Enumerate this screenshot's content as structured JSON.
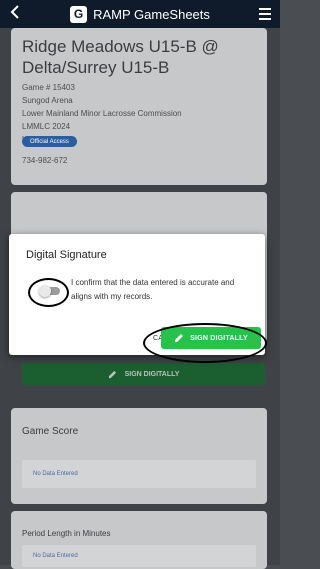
{
  "header": {
    "back_icon": "chevron-left-icon",
    "logo_letter": "G",
    "title": "RAMP GameSheets",
    "menu_icon": "hamburger-icon"
  },
  "game": {
    "title": "Ridge Meadows U15-B @ Delta/Surrey U15-B",
    "game_number": "Game # 15403",
    "arena": "Sungod Arena",
    "association": "Lower Mainland Minor Lacrosse Commission",
    "league": "LMMLC 2024",
    "division": "U-15 B",
    "badge": "Official Access",
    "phone": "734-982-672"
  },
  "signature_section": {
    "button_label": "SIGN DIGITALLY",
    "button_icon": "pencil-icon"
  },
  "modal": {
    "title": "Digital Signature",
    "message": "I confirm that the data entered is accurate and aligns with my records.",
    "cancel_label": "CANCEL",
    "sign_label": "SIGN DIGITALLY",
    "toggle_checked": false
  },
  "score": {
    "heading": "Game Score",
    "empty": "No Data Entered"
  },
  "period": {
    "heading": "Period Length in Minutes",
    "empty": "No Data Entered"
  },
  "colors": {
    "topbar": "#0f1a2b",
    "sign_green": "#27c24c",
    "badge_blue": "#2c5d9e"
  }
}
